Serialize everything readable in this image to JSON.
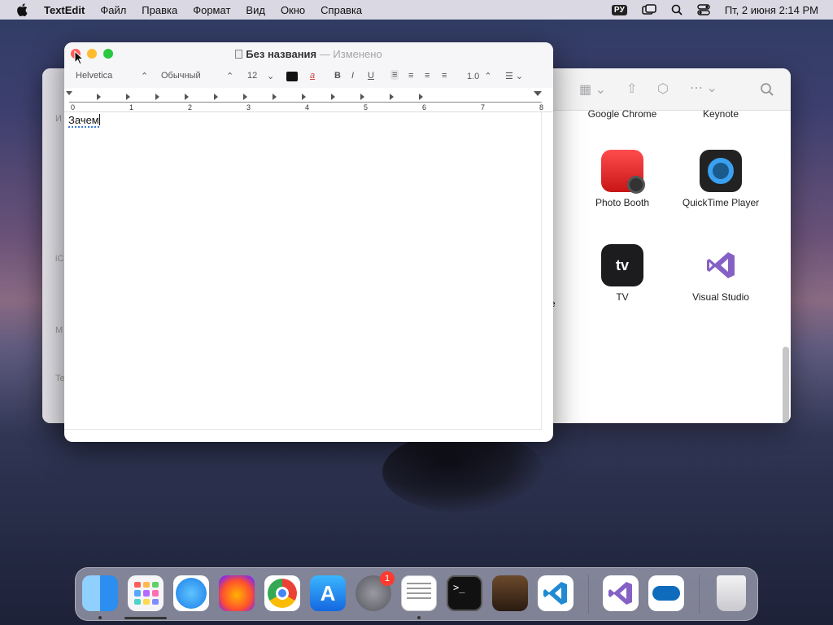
{
  "menubar": {
    "app_name": "TextEdit",
    "items": [
      "Файл",
      "Правка",
      "Формат",
      "Вид",
      "Окно",
      "Справка"
    ],
    "input_source": "PУ",
    "datetime": "Пт, 2 июня  2:14 PM"
  },
  "textedit": {
    "title": "Без названия",
    "title_sep": "—",
    "status": "Изменено",
    "toolbar": {
      "font": "Helvetica",
      "style": "Обычный",
      "size": "12",
      "bold": "B",
      "italic": "I",
      "underline": "U",
      "spacing": "1.0"
    },
    "ruler_numbers": [
      "0",
      "1",
      "2",
      "3",
      "4",
      "5",
      "6",
      "7",
      "8"
    ],
    "document_text": "Зачем"
  },
  "finder": {
    "apps": [
      {
        "name": "Google Chrome"
      },
      {
        "name": "Keynote"
      },
      {
        "name": "Photo Booth"
      },
      {
        "name": "QuickTime Player"
      },
      {
        "name": "TV"
      },
      {
        "name": "Visual Studio"
      }
    ],
    "partial_label": "e",
    "sidebar_letters": [
      "И",
      "iC",
      "M",
      "Te"
    ]
  },
  "dock": {
    "system_settings_badge": "1",
    "apps": [
      "Finder",
      "Launchpad",
      "Safari",
      "Firefox",
      "Google Chrome",
      "App Store",
      "System Settings",
      "TextEdit",
      "Terminal",
      "GarageBand",
      "Visual Studio Code",
      "Visual Studio",
      "OneDrive",
      "Trash"
    ]
  },
  "colors": {
    "close": "#ff5f57",
    "minimize": "#febc2e",
    "zoom": "#28c840",
    "accent": "#3b7cd6"
  }
}
